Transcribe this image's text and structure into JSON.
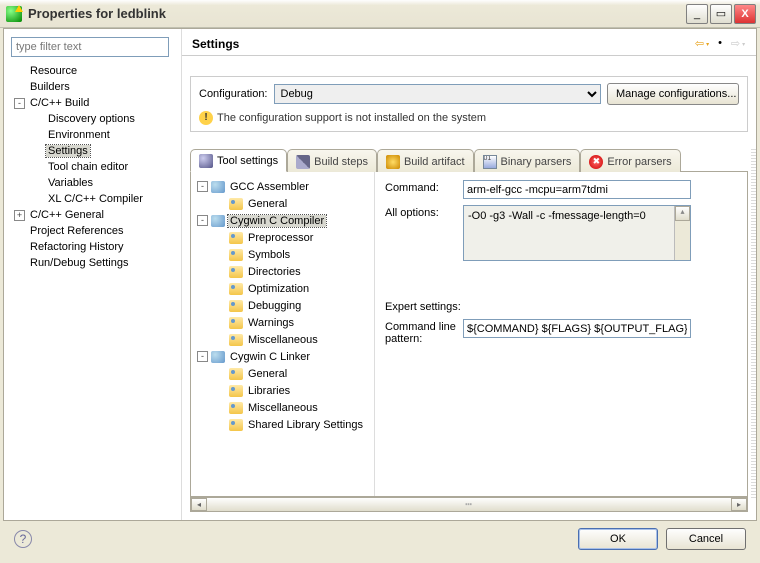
{
  "titlebar": {
    "title": "Properties for ledblink"
  },
  "filter": {
    "placeholder": "type filter text"
  },
  "nav_tree": [
    {
      "label": "Resource",
      "depth": 0,
      "twisty": ""
    },
    {
      "label": "Builders",
      "depth": 0,
      "twisty": ""
    },
    {
      "label": "C/C++ Build",
      "depth": 0,
      "twisty": "-"
    },
    {
      "label": "Discovery options",
      "depth": 1,
      "twisty": ""
    },
    {
      "label": "Environment",
      "depth": 1,
      "twisty": ""
    },
    {
      "label": "Settings",
      "depth": 1,
      "twisty": "",
      "selected": true
    },
    {
      "label": "Tool chain editor",
      "depth": 1,
      "twisty": ""
    },
    {
      "label": "Variables",
      "depth": 1,
      "twisty": ""
    },
    {
      "label": "XL C/C++ Compiler",
      "depth": 1,
      "twisty": ""
    },
    {
      "label": "C/C++ General",
      "depth": 0,
      "twisty": "+"
    },
    {
      "label": "Project References",
      "depth": 0,
      "twisty": ""
    },
    {
      "label": "Refactoring History",
      "depth": 0,
      "twisty": ""
    },
    {
      "label": "Run/Debug Settings",
      "depth": 0,
      "twisty": ""
    }
  ],
  "header": {
    "title": "Settings"
  },
  "config": {
    "label": "Configuration:",
    "value": "Debug",
    "manage_btn": "Manage configurations...",
    "warning": "The configuration support is not installed on the system"
  },
  "tabs": [
    {
      "id": "tool-settings",
      "label": "Tool settings",
      "icon": "ti-wrench",
      "active": true
    },
    {
      "id": "build-steps",
      "label": "Build steps",
      "icon": "ti-steps"
    },
    {
      "id": "build-artifact",
      "label": "Build artifact",
      "icon": "ti-trophy"
    },
    {
      "id": "binary-parsers",
      "label": "Binary parsers",
      "icon": "ti-binary"
    },
    {
      "id": "error-parsers",
      "label": "Error parsers",
      "icon": "ti-error"
    }
  ],
  "tool_tree": [
    {
      "label": "GCC Assembler",
      "depth": 0,
      "twisty": "-",
      "icon": "cat"
    },
    {
      "label": "General",
      "depth": 1,
      "icon": "opt"
    },
    {
      "label": "Cygwin C Compiler",
      "depth": 0,
      "twisty": "-",
      "icon": "cat",
      "selected": true
    },
    {
      "label": "Preprocessor",
      "depth": 1,
      "icon": "opt"
    },
    {
      "label": "Symbols",
      "depth": 1,
      "icon": "opt"
    },
    {
      "label": "Directories",
      "depth": 1,
      "icon": "opt"
    },
    {
      "label": "Optimization",
      "depth": 1,
      "icon": "opt"
    },
    {
      "label": "Debugging",
      "depth": 1,
      "icon": "opt"
    },
    {
      "label": "Warnings",
      "depth": 1,
      "icon": "opt"
    },
    {
      "label": "Miscellaneous",
      "depth": 1,
      "icon": "opt"
    },
    {
      "label": "Cygwin C Linker",
      "depth": 0,
      "twisty": "-",
      "icon": "cat"
    },
    {
      "label": "General",
      "depth": 1,
      "icon": "opt"
    },
    {
      "label": "Libraries",
      "depth": 1,
      "icon": "opt"
    },
    {
      "label": "Miscellaneous",
      "depth": 1,
      "icon": "opt"
    },
    {
      "label": "Shared Library Settings",
      "depth": 1,
      "icon": "opt"
    }
  ],
  "form": {
    "command_label": "Command:",
    "command_value": "arm-elf-gcc -mcpu=arm7tdmi",
    "alloptions_label": "All options:",
    "alloptions_value": "-O0 -g3 -Wall -c -fmessage-length=0",
    "expert_label": "Expert settings:",
    "pattern_label": "Command line pattern:",
    "pattern_value": "${COMMAND} ${FLAGS} ${OUTPUT_FLAG}"
  },
  "buttons": {
    "ok": "OK",
    "cancel": "Cancel"
  }
}
